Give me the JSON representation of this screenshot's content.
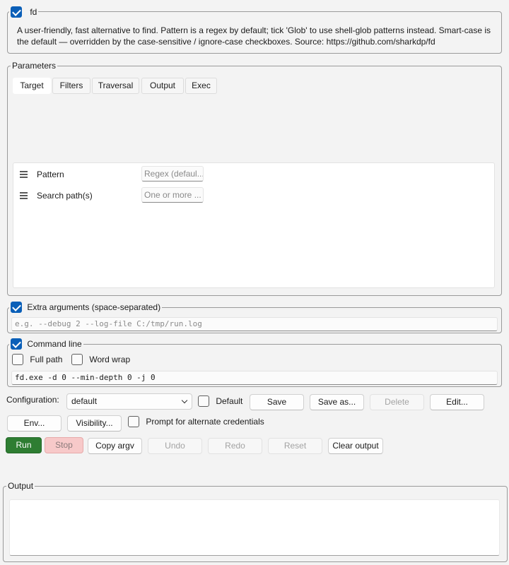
{
  "tool": {
    "name": "fd",
    "enabled": true,
    "description": "A user-friendly, fast alternative to find. Pattern is a regex by default; tick 'Glob' to use shell-glob patterns instead. Smart-case is the default — overridden by the case-sensitive / ignore-case checkboxes. Source: https://github.com/sharkdp/fd"
  },
  "parameters": {
    "legend": "Parameters",
    "tabs": [
      {
        "label": "Target",
        "active": true
      },
      {
        "label": "Filters"
      },
      {
        "label": "Traversal"
      },
      {
        "label": "Output"
      },
      {
        "label": "Exec"
      }
    ],
    "rows": [
      {
        "label": "Pattern",
        "placeholder": "Regex (defaul..."
      },
      {
        "label": "Search path(s)",
        "placeholder": "One or more ..."
      }
    ]
  },
  "extra_args": {
    "legend": "Extra arguments (space-separated)",
    "checked": true,
    "placeholder": "e.g. --debug 2 --log-file C:/tmp/run.log"
  },
  "command_line": {
    "legend": "Command line",
    "checked": true,
    "full_path_label": "Full path",
    "word_wrap_label": "Word wrap",
    "value": "fd.exe -d 0 --min-depth 0 -j 0"
  },
  "configuration": {
    "label": "Configuration:",
    "selected": "default",
    "default_label": "Default",
    "save": "Save",
    "save_as": "Save as...",
    "delete": "Delete",
    "edit": "Edit..."
  },
  "options_row": {
    "env": "Env...",
    "visibility": "Visibility...",
    "prompt_credentials": "Prompt for alternate credentials"
  },
  "actions": {
    "run": "Run",
    "stop": "Stop",
    "copy_argv": "Copy argv",
    "undo": "Undo",
    "redo": "Redo",
    "reset": "Reset",
    "clear_output": "Clear output"
  },
  "output": {
    "legend": "Output"
  },
  "colors": {
    "accent": "#0a5fb8",
    "run": "#2e7d32",
    "stop": "#f7c9c9"
  }
}
